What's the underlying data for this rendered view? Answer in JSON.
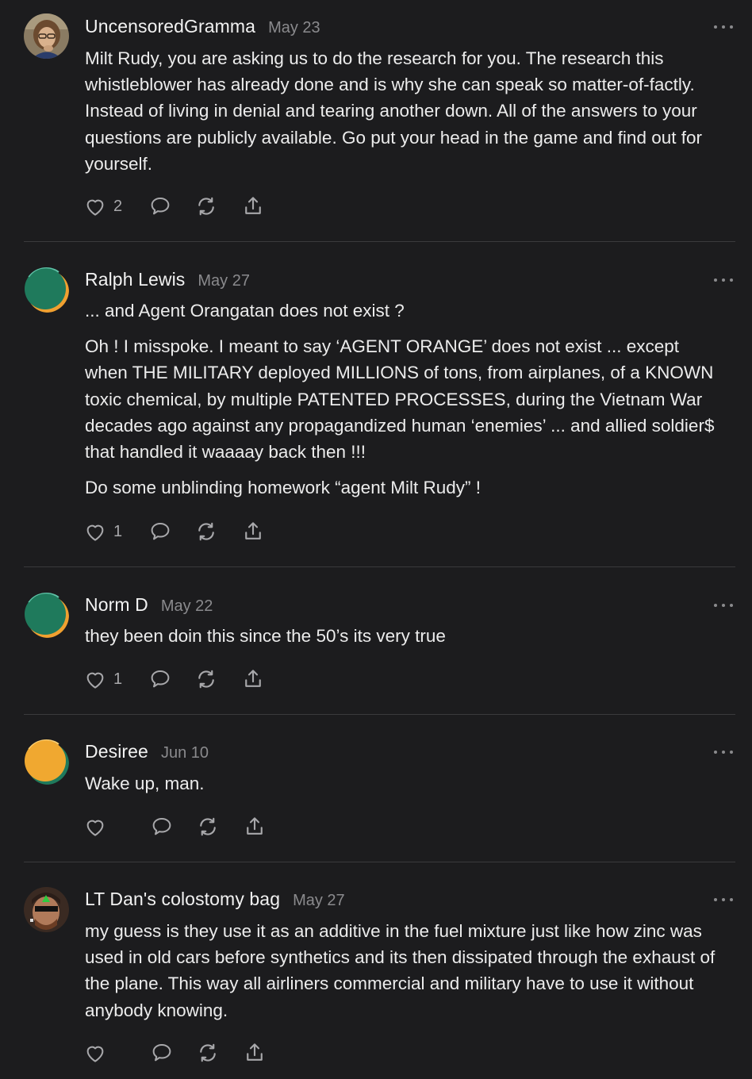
{
  "comments": [
    {
      "author": "UncensoredGramma",
      "date": "May 23",
      "avatar_type": "photo-gramma",
      "paragraphs": [
        "Milt Rudy, you are asking us to do the research for you. The research this whistleblower has already done and is why she can speak so matter-of-factly. Instead of living in denial and tearing another down. All of the answers to your questions are publicly available. Go put your head in the game and find out for yourself."
      ],
      "likes": "2"
    },
    {
      "author": "Ralph Lewis",
      "date": "May 27",
      "avatar_type": "green-orange-circle",
      "paragraphs": [
        "... and Agent Orangatan does not exist ?",
        "Oh ! I misspoke. I meant to say ‘AGENT ORANGE’ does not exist ... except when THE MILITARY deployed MILLIONS of tons, from airplanes, of a KNOWN toxic chemical, by multiple PATENTED PROCESSES, during the Vietnam War decades ago against any propagandized human ‘enemies’ ... and allied soldier$ that handled it waaaay back then !!!",
        "Do some unblinding homework “agent Milt Rudy” !"
      ],
      "likes": "1"
    },
    {
      "author": "Norm D",
      "date": "May 22",
      "avatar_type": "green-orange-circle",
      "paragraphs": [
        "they been doin this since the 50’s its very true"
      ],
      "likes": "1"
    },
    {
      "author": "Desiree",
      "date": "Jun 10",
      "avatar_type": "orange-green-circle",
      "paragraphs": [
        "Wake up, man."
      ],
      "likes": ""
    },
    {
      "author": "LT Dan's colostomy bag",
      "date": "May 27",
      "avatar_type": "photo-ltdan",
      "paragraphs": [
        "my guess is they use it as an additive in the fuel mixture just like how zinc was used in old cars before synthetics and its then dissipated through the exhaust of the plane. This way all airliners commercial and military have to use it without anybody knowing."
      ],
      "likes": ""
    }
  ],
  "icons": {
    "like": "heart-icon",
    "reply": "comment-bubble-icon",
    "restack": "restack-icon",
    "share": "share-icon",
    "more": "more-options-icon"
  },
  "colors": {
    "background": "#1c1c1e",
    "text": "#ececec",
    "muted": "#8a8a8d",
    "divider": "#3a3a3c",
    "avatar_green": "#1f7a5c",
    "avatar_orange": "#f0a030"
  }
}
